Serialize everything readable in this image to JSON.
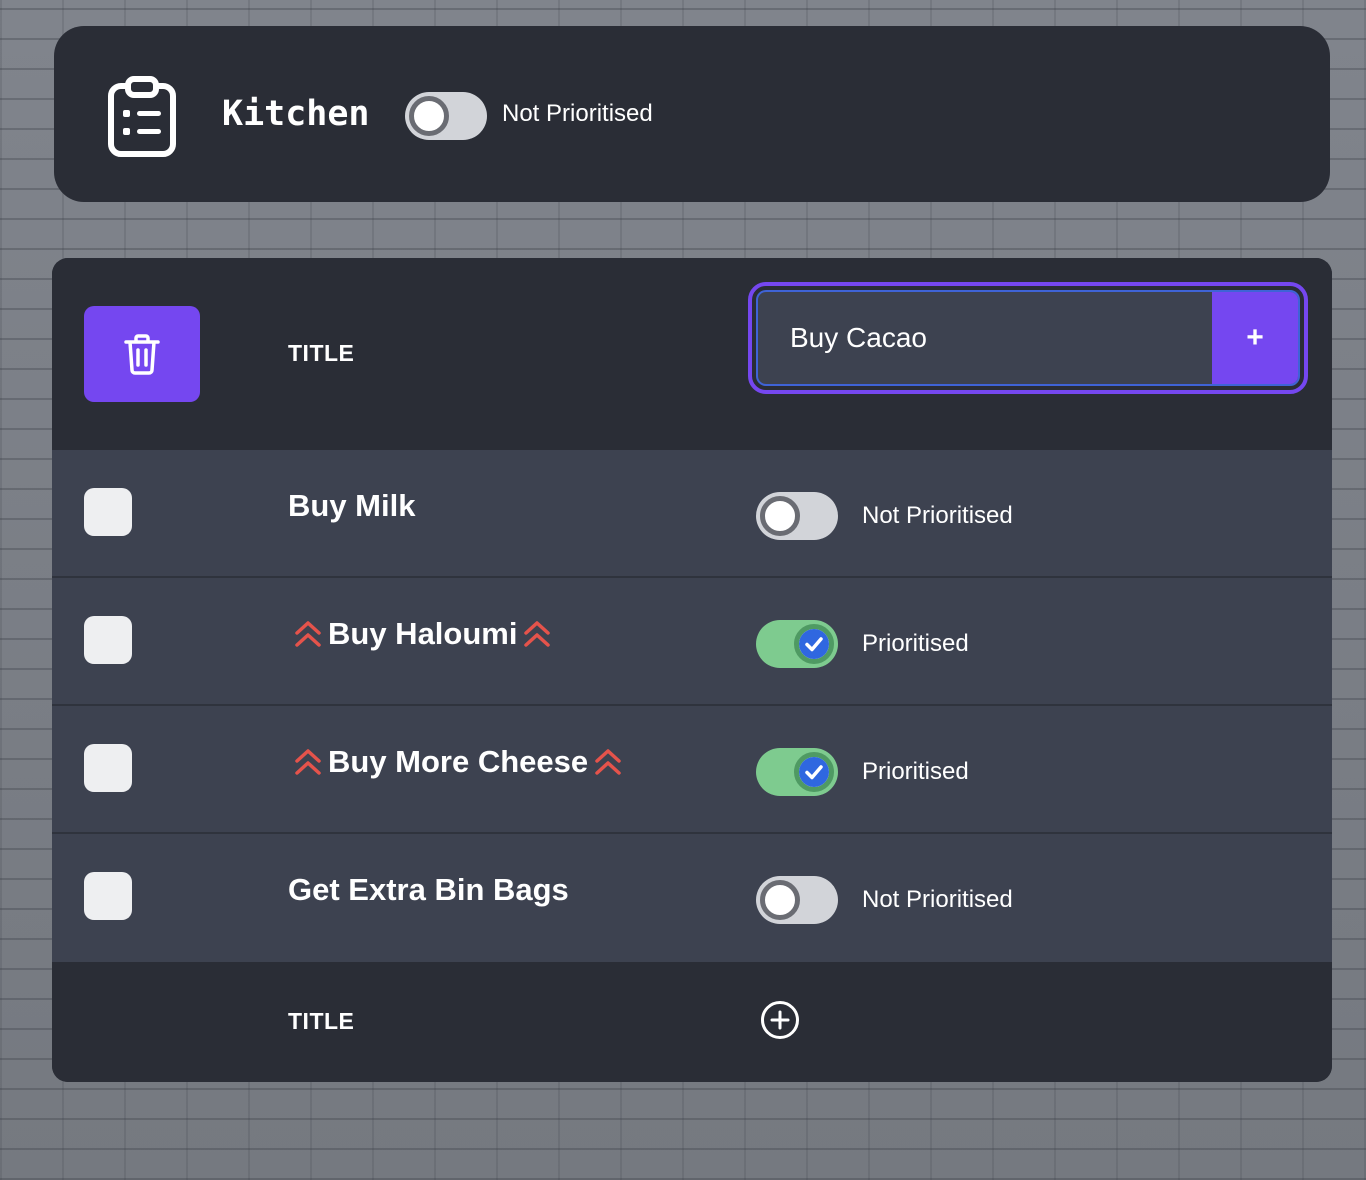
{
  "header": {
    "title": "Kitchen",
    "icon": "clipboard-list-icon",
    "priority_toggle_on": false,
    "priority_label": "Not Prioritised"
  },
  "table": {
    "delete_icon": "trash-icon",
    "column_title": "TITLE",
    "new_item_value": "Buy Cacao",
    "add_label": "+",
    "rows": [
      {
        "title": "Buy Milk",
        "prioritised": false,
        "status": "Not Prioritised"
      },
      {
        "title": "Buy Haloumi",
        "prioritised": true,
        "status": "Prioritised"
      },
      {
        "title": "Buy More Cheese",
        "prioritised": true,
        "status": "Prioritised"
      },
      {
        "title": "Get Extra Bin Bags",
        "prioritised": false,
        "status": "Not Prioritised"
      }
    ],
    "footer_title": "TITLE",
    "footer_add_icon": "plus-circle-icon"
  },
  "colors": {
    "accent": "#7547f0",
    "card_dark": "#2a2d36",
    "row_bg": "#3d4250",
    "toggle_on": "#7ecb8f",
    "priority_icon": "#e5534b",
    "check": "#2f67e0"
  }
}
